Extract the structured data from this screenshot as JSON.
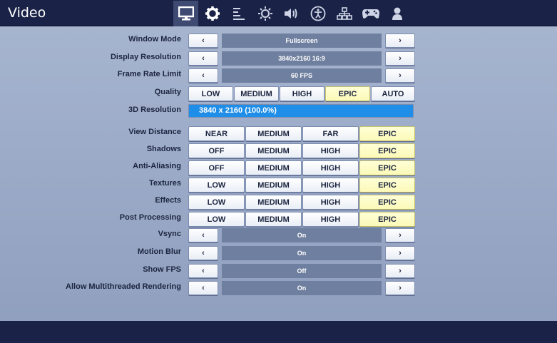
{
  "header": {
    "title": "Video",
    "tabs": [
      {
        "icon": "monitor-icon",
        "active": true
      },
      {
        "icon": "gear-icon",
        "active": false
      },
      {
        "icon": "list-icon",
        "active": false
      },
      {
        "icon": "brightness-icon",
        "active": false
      },
      {
        "icon": "speaker-icon",
        "active": false
      },
      {
        "icon": "accessibility-icon",
        "active": false
      },
      {
        "icon": "network-icon",
        "active": false
      },
      {
        "icon": "gamepad-icon",
        "active": false
      },
      {
        "icon": "account-icon",
        "active": false
      }
    ]
  },
  "colors": {
    "header_bg": "#1a2347",
    "selected_option": "#fbf9b8",
    "resolution_fill": "#1f8ee8",
    "value_field": "#6f7f9f"
  },
  "settings": {
    "window_mode": {
      "label": "Window Mode",
      "value": "Fullscreen"
    },
    "display_resolution": {
      "label": "Display Resolution",
      "value": "3840x2160 16:9"
    },
    "frame_rate_limit": {
      "label": "Frame Rate Limit",
      "value": "60 FPS"
    },
    "quality": {
      "label": "Quality",
      "options": [
        "LOW",
        "MEDIUM",
        "HIGH",
        "EPIC",
        "AUTO"
      ],
      "selected": "EPIC"
    },
    "resolution_3d": {
      "label": "3D Resolution",
      "value": "3840 x 2160 (100.0%)",
      "percent": 100
    },
    "view_distance": {
      "label": "View Distance",
      "options": [
        "NEAR",
        "MEDIUM",
        "FAR",
        "EPIC"
      ],
      "selected": "EPIC"
    },
    "shadows": {
      "label": "Shadows",
      "options": [
        "OFF",
        "MEDIUM",
        "HIGH",
        "EPIC"
      ],
      "selected": "EPIC"
    },
    "anti_aliasing": {
      "label": "Anti-Aliasing",
      "options": [
        "OFF",
        "MEDIUM",
        "HIGH",
        "EPIC"
      ],
      "selected": "EPIC"
    },
    "textures": {
      "label": "Textures",
      "options": [
        "LOW",
        "MEDIUM",
        "HIGH",
        "EPIC"
      ],
      "selected": "EPIC"
    },
    "effects": {
      "label": "Effects",
      "options": [
        "LOW",
        "MEDIUM",
        "HIGH",
        "EPIC"
      ],
      "selected": "EPIC"
    },
    "post_processing": {
      "label": "Post Processing",
      "options": [
        "LOW",
        "MEDIUM",
        "HIGH",
        "EPIC"
      ],
      "selected": "EPIC"
    },
    "vsync": {
      "label": "Vsync",
      "value": "On"
    },
    "motion_blur": {
      "label": "Motion Blur",
      "value": "On"
    },
    "show_fps": {
      "label": "Show FPS",
      "value": "Off"
    },
    "multithreaded": {
      "label": "Allow Multithreaded Rendering",
      "value": "On"
    }
  },
  "arrows": {
    "left": "‹",
    "right": "›"
  }
}
